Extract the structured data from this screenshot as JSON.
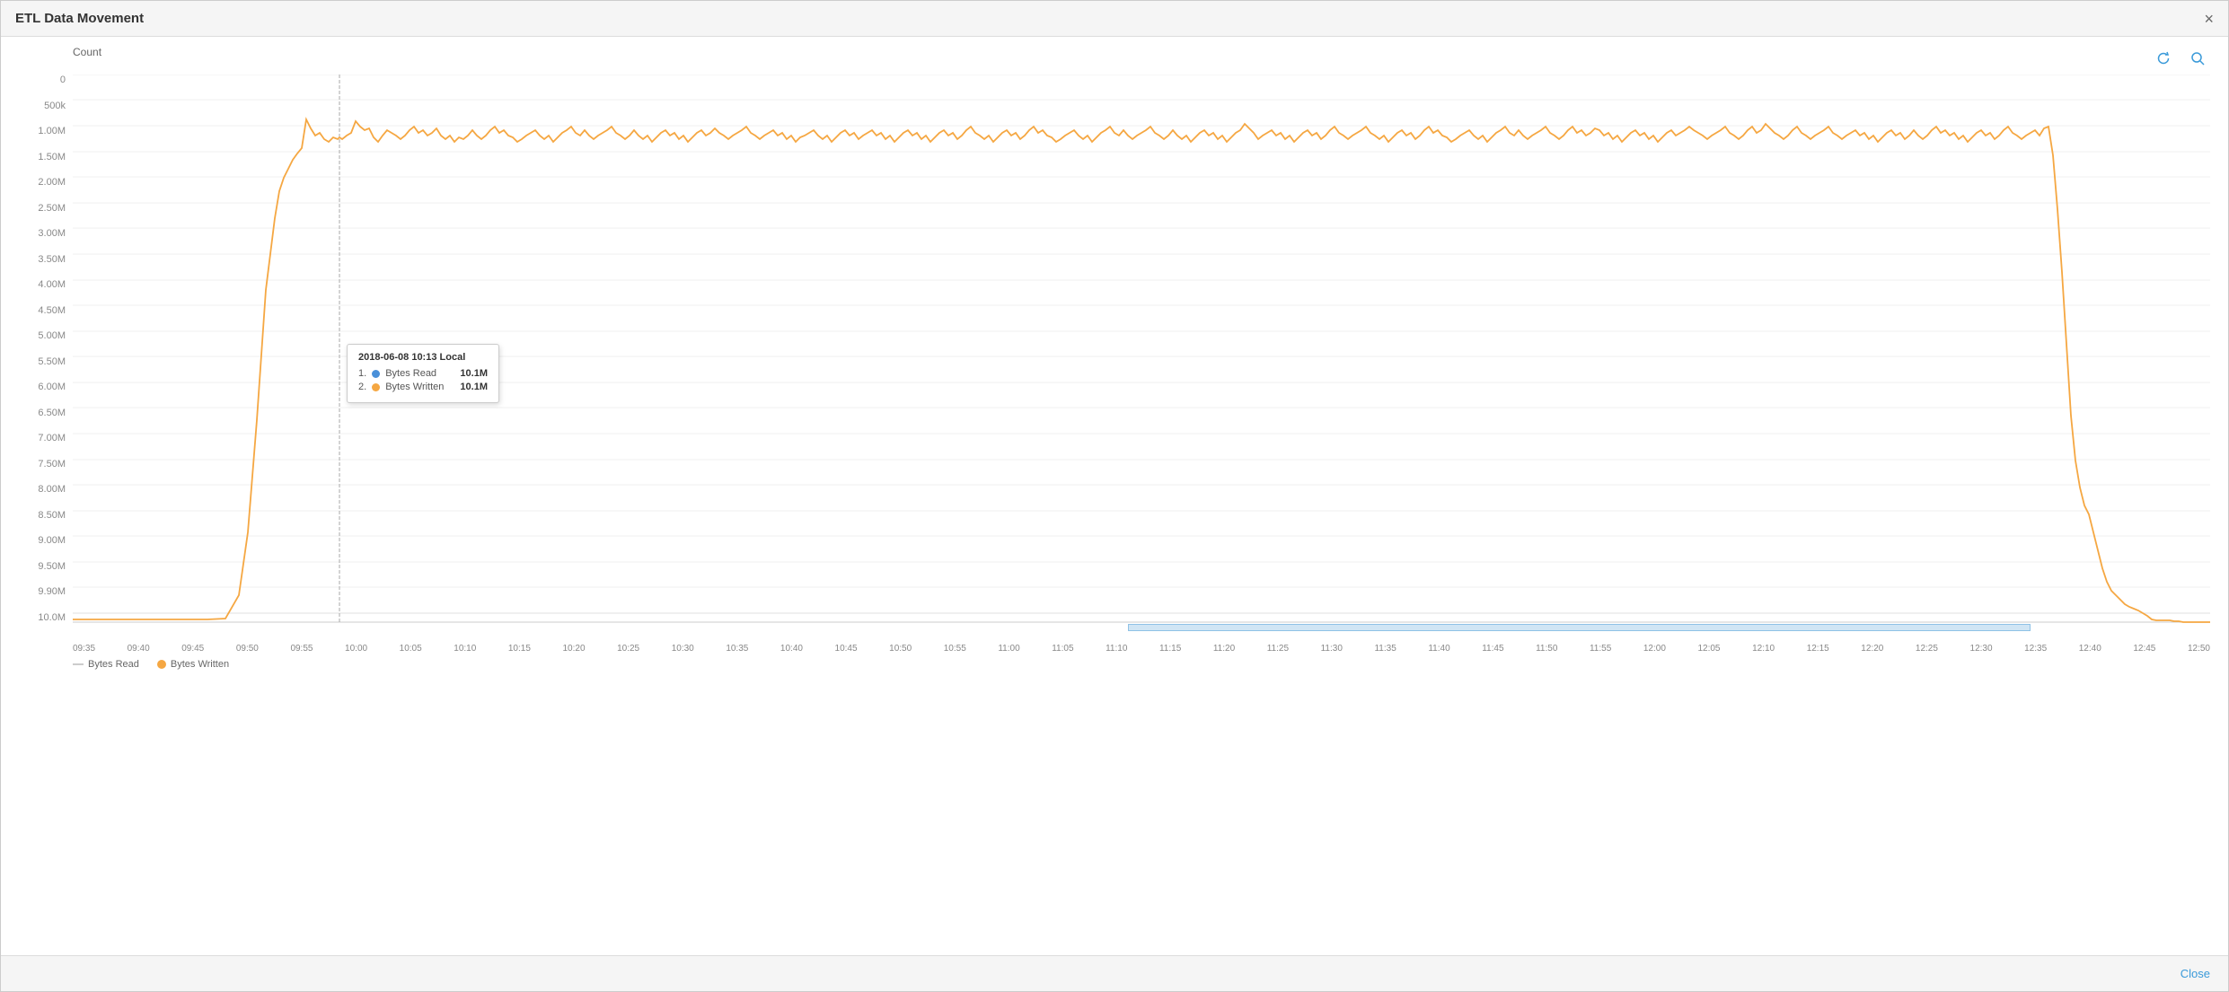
{
  "window": {
    "title": "ETL Data Movement",
    "close_icon": "×"
  },
  "toolbar": {
    "count_label": "Count",
    "refresh_icon": "↻",
    "search_icon": "🔍"
  },
  "chart": {
    "y_labels": [
      "0",
      "500k",
      "1.00M",
      "1.50M",
      "2.00M",
      "2.50M",
      "3.00M",
      "3.50M",
      "4.00M",
      "4.50M",
      "5.00M",
      "5.50M",
      "6.00M",
      "6.50M",
      "7.00M",
      "7.50M",
      "8.00M",
      "8.50M",
      "9.00M",
      "9.50M",
      "9.90M",
      "10.0M"
    ],
    "x_labels": [
      "09:35",
      "09:40",
      "09:45",
      "09:50",
      "09:55",
      "10:00",
      "10:05",
      "10:10",
      "10:15",
      "10:20",
      "10:25",
      "10:30",
      "10:35",
      "10:40",
      "10:45",
      "10:50",
      "10:55",
      "11:00",
      "11:05",
      "11:10",
      "11:15",
      "11:20",
      "11:25",
      "11:30",
      "11:35",
      "11:40",
      "11:45",
      "11:50",
      "11:55",
      "12:00",
      "12:05",
      "12:10",
      "12:15",
      "12:20",
      "12:25",
      "12:30",
      "12:35",
      "12:40",
      "12:45",
      "12:50"
    ]
  },
  "legend": {
    "bytes_read_label": "Bytes Read",
    "bytes_written_label": "Bytes Written",
    "bytes_read_color": "#cccccc",
    "bytes_written_color": "#f5a742"
  },
  "tooltip": {
    "title": "2018-06-08 10:13 Local",
    "row1_index": "1.",
    "row1_name": "Bytes Read",
    "row1_value": "10.1M",
    "row1_color": "#4a90d9",
    "row2_index": "2.",
    "row2_name": "Bytes Written",
    "row2_value": "10.1M",
    "row2_color": "#f5a742"
  },
  "footer": {
    "close_label": "Close"
  }
}
